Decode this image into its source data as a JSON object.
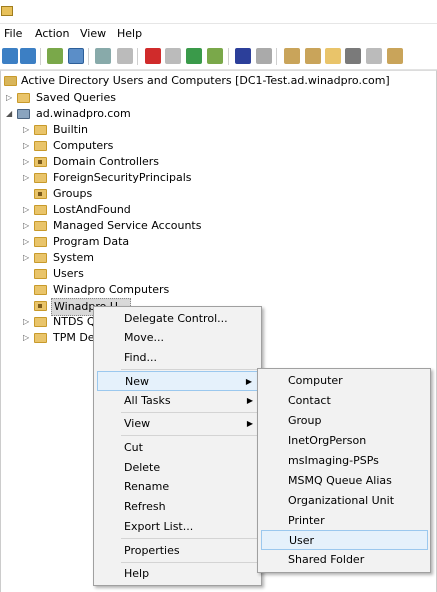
{
  "menubar": [
    "File",
    "Action",
    "View",
    "Help"
  ],
  "tree": {
    "root": "Active Directory Users and Computers [DC1-Test.ad.winadpro.com]",
    "saved_queries": "Saved Queries",
    "domain": "ad.winadpro.com",
    "items": [
      "Builtin",
      "Computers",
      "Domain Controllers",
      "ForeignSecurityPrincipals",
      "Groups",
      "LostAndFound",
      "Managed Service Accounts",
      "Program Data",
      "System",
      "Users",
      "Winadpro Computers",
      "Winadpro Users",
      "NTDS Quotas",
      "TPM Devices"
    ],
    "visible_items": [
      "Builtin",
      "Computers",
      "Domain Controllers",
      "ForeignSecurityPrincipals",
      "Groups",
      "LostAndFound",
      "Managed Service Accounts",
      "Program Data",
      "System",
      "Users",
      "Winadpro Computers",
      "Winadpro U",
      "NTDS Qu",
      "TPM Dev"
    ]
  },
  "context_menu": [
    "Delegate Control...",
    "Move...",
    "Find...",
    "New",
    "All Tasks",
    "View",
    "Cut",
    "Delete",
    "Rename",
    "Refresh",
    "Export List...",
    "Properties",
    "Help"
  ],
  "submenu": [
    "Computer",
    "Contact",
    "Group",
    "InetOrgPerson",
    "msImaging-PSPs",
    "MSMQ Queue Alias",
    "Organizational Unit",
    "Printer",
    "User",
    "Shared Folder"
  ],
  "colors": {
    "folder": "#e9c46a",
    "highlight": "#e5f1fb",
    "menu_bg": "#f2f2f2"
  }
}
